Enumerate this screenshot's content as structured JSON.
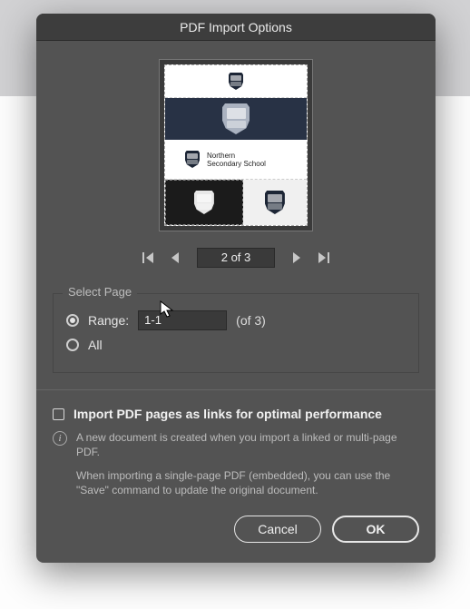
{
  "dialog": {
    "title": "PDF Import Options"
  },
  "preview": {
    "row3_line1": "Northern",
    "row3_line2": "Secondary School"
  },
  "pager": {
    "value": "2 of 3"
  },
  "select_page": {
    "label": "Select Page",
    "range_label": "Range:",
    "range_value": "1-1",
    "range_suffix": "(of 3)",
    "all_label": "All"
  },
  "import_links": {
    "checkbox_label": "Import PDF pages as links for optimal performance",
    "info_p1": "A new document is created when you import a linked or multi-page PDF.",
    "info_p2": "When importing a single-page PDF (embedded), you can use the \"Save\" command to update the original document."
  },
  "buttons": {
    "cancel": "Cancel",
    "ok": "OK"
  }
}
